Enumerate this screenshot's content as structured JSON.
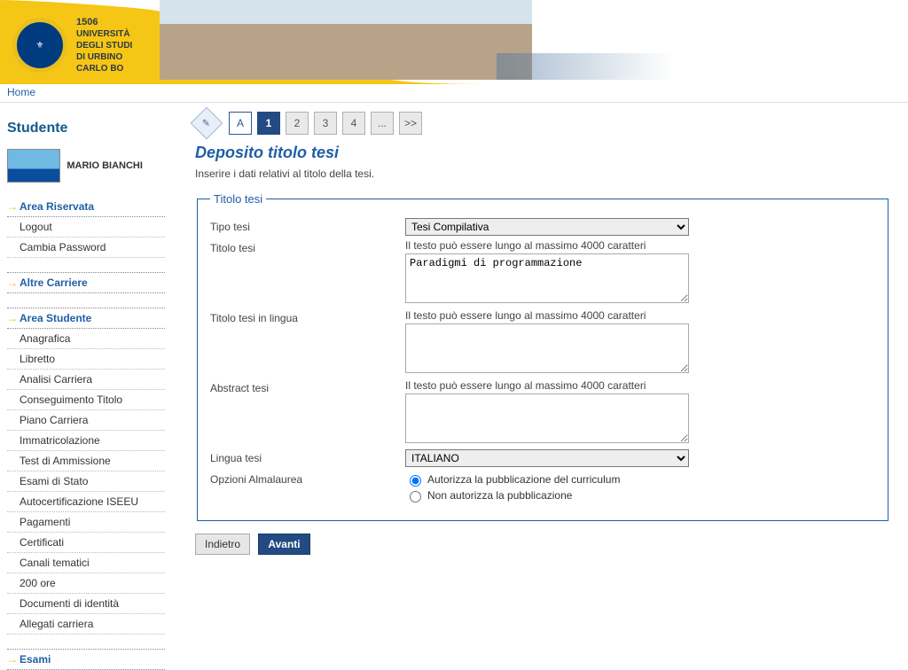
{
  "header": {
    "logo_year": "1506",
    "logo_lines": [
      "UNIVERSITÀ",
      "DEGLI STUDI",
      "DI URBINO",
      "CARLO BO"
    ],
    "tab_home": "Home"
  },
  "sidebar": {
    "title": "Studente",
    "user_name": "MARIO BIANCHI",
    "groups": [
      {
        "title": "Area Riservata",
        "items": [
          "Logout",
          "Cambia Password"
        ]
      },
      {
        "title": "Altre Carriere",
        "items": []
      },
      {
        "title": "Area Studente",
        "items": [
          "Anagrafica",
          "Libretto",
          "Analisi Carriera",
          "Conseguimento Titolo",
          "Piano Carriera",
          "Immatricolazione",
          "Test di Ammissione",
          "Esami di Stato",
          "Autocertificazione ISEEU",
          "Pagamenti",
          "Certificati",
          "Canali tematici",
          "200 ore",
          "Documenti di identità",
          "Allegati carriera"
        ]
      },
      {
        "title": "Esami",
        "items": []
      }
    ]
  },
  "steps": [
    "A",
    "1",
    "2",
    "3",
    "4",
    "...",
    ">>"
  ],
  "steps_current_index": 1,
  "page": {
    "heading": "Deposito titolo tesi",
    "desc": "Inserire i dati relativi al titolo della tesi.",
    "legend": "Titolo tesi"
  },
  "form": {
    "tipo_label": "Tipo tesi",
    "tipo_value": "Tesi Compilativa",
    "max_hint": "Il testo può essere lungo al massimo 4000 caratteri",
    "titolo_label": "Titolo tesi",
    "titolo_value": "Paradigmi di programmazione",
    "titolo_lingua_label": "Titolo tesi in lingua",
    "titolo_lingua_value": "",
    "abstract_label": "Abstract tesi",
    "abstract_value": "",
    "lingua_label": "Lingua tesi",
    "lingua_value": "ITALIANO",
    "alma_label": "Opzioni Almalaurea",
    "alma_opt1": "Autorizza la pubblicazione del curriculum",
    "alma_opt2": "Non autorizza la pubblicazione",
    "alma_selected": "opt1"
  },
  "buttons": {
    "back": "Indietro",
    "forward": "Avanti"
  }
}
